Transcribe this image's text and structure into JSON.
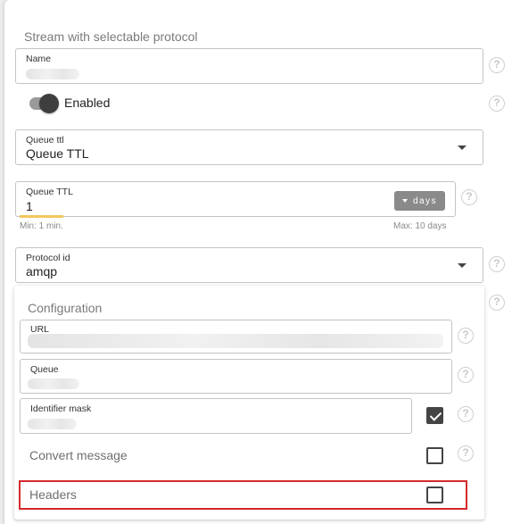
{
  "section_title": "Stream with selectable protocol",
  "name_field": {
    "label": "Name",
    "value": ""
  },
  "enabled_toggle": {
    "label": "Enabled",
    "on": true
  },
  "queue_ttl_select": {
    "label": "Queue ttl",
    "value": "Queue TTL"
  },
  "queue_ttl_input": {
    "label": "Queue TTL",
    "value": "1",
    "unit": "days",
    "min_hint": "Min: 1 min.",
    "max_hint": "Max: 10 days",
    "progress_fraction": 0.1
  },
  "protocol_select": {
    "label": "Protocol id",
    "value": "amqp"
  },
  "configuration": {
    "title": "Configuration",
    "url_field": {
      "label": "URL",
      "value": ""
    },
    "queue_field": {
      "label": "Queue",
      "value": ""
    },
    "identifier_mask_field": {
      "label": "Identifier mask",
      "value": "",
      "checked": true
    },
    "convert_message": {
      "label": "Convert message",
      "checked": false
    },
    "headers": {
      "label": "Headers",
      "checked": false
    }
  },
  "help_icon_glyph": "?",
  "colors": {
    "highlight_border": "#d4282c",
    "progress": "#f3c85c",
    "unit_button": "#8a8a8a"
  }
}
